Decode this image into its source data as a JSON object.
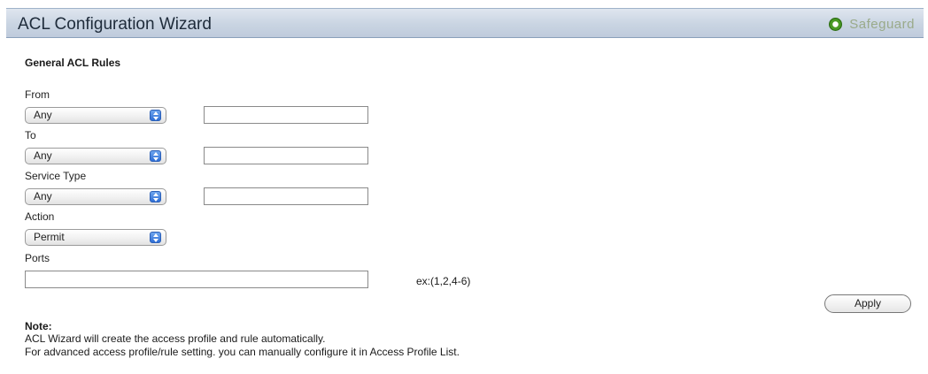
{
  "header": {
    "title": "ACL Configuration Wizard",
    "status_label": "Safeguard"
  },
  "section_title": "General ACL Rules",
  "fields": {
    "from": {
      "label": "From",
      "selected": "Any",
      "value": ""
    },
    "to": {
      "label": "To",
      "selected": "Any",
      "value": ""
    },
    "service_type": {
      "label": "Service Type",
      "selected": "Any",
      "value": ""
    },
    "action": {
      "label": "Action",
      "selected": "Permit"
    },
    "ports": {
      "label": "Ports",
      "value": "",
      "hint": "ex:(1,2,4-6)"
    }
  },
  "apply_label": "Apply",
  "note": {
    "title": "Note:",
    "lines": [
      "ACL Wizard will create the access profile and rule automatically.",
      "For advanced access profile/rule setting. you can manually configure it in Access Profile List."
    ]
  },
  "colors": {
    "header_bg": "#c9d4e2",
    "status_green": "#4a9a25",
    "select_arrow": "#2f6fd6"
  }
}
